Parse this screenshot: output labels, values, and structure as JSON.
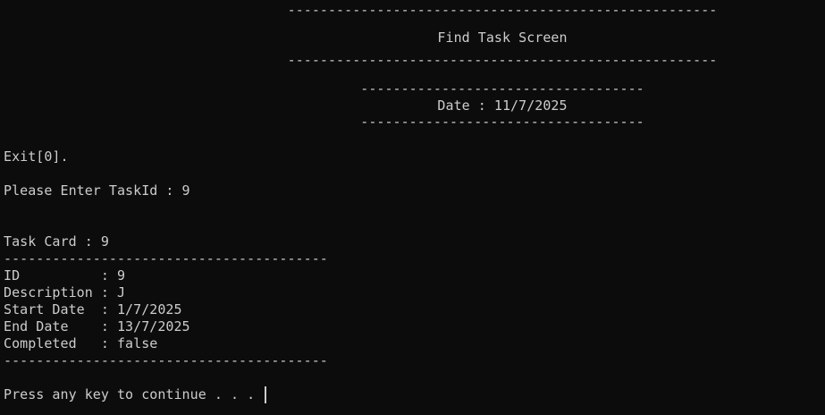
{
  "header": {
    "rule_top": "-----------------------------------------------------",
    "title": "Find Task Screen",
    "rule_bottom": "-----------------------------------------------------"
  },
  "date_box": {
    "rule_top": "-----------------------------------",
    "date_line": "Date : 11/7/2025",
    "rule_bottom": "-----------------------------------"
  },
  "menu": {
    "exit_option": "Exit[0]."
  },
  "prompt": {
    "task_id_line": "Please Enter TaskId : 9"
  },
  "task_card": {
    "title": "Task Card : 9",
    "rule_top": "----------------------------------------",
    "id_line": "ID          : 9",
    "description_line": "Description : J",
    "start_date_line": "Start Date  : 1/7/2025",
    "end_date_line": "End Date    : 13/7/2025",
    "completed_line": "Completed   : false",
    "rule_bottom": "----------------------------------------"
  },
  "footer": {
    "continue_prompt": "Press any key to continue . . . "
  }
}
